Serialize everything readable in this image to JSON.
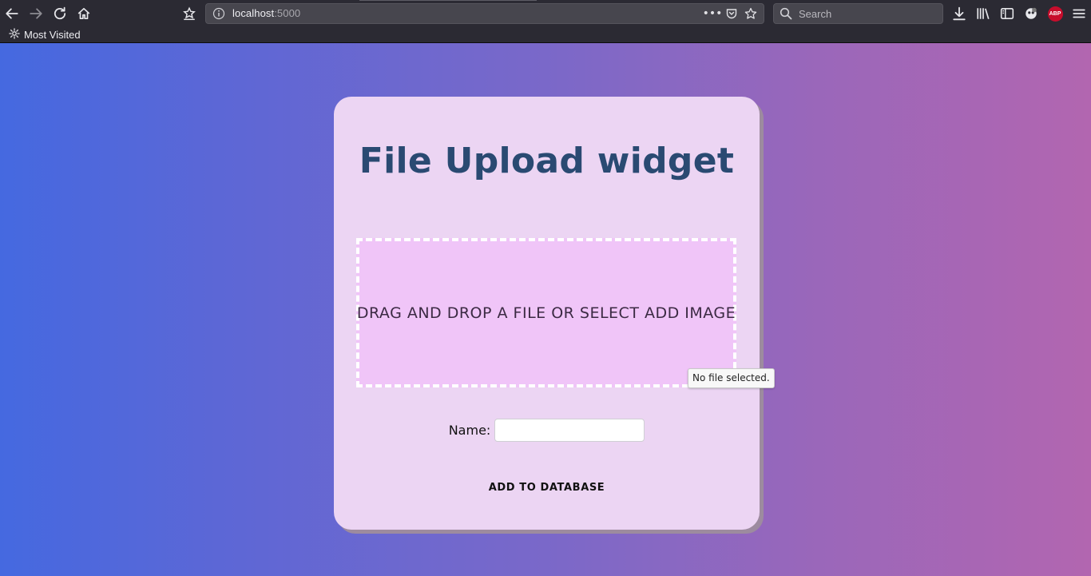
{
  "browser": {
    "url_host": "localhost",
    "url_port": ":5000",
    "search_placeholder": "Search",
    "bookmarks": [
      {
        "label": "Most Visited",
        "icon": "gear-icon"
      }
    ],
    "abp_label": "ABP",
    "colors": {
      "chrome_bg": "#2b2a33",
      "urlbar_bg": "#47464e"
    }
  },
  "card": {
    "title": "File Upload widget",
    "dropzone_text": "DRAG AND DROP A FILE OR SELECT ADD IMAGE",
    "file_tooltip": "No file selected.",
    "name_label": "Name:",
    "name_value": "",
    "submit_label": "ADD TO DATABASE"
  },
  "theme": {
    "gradient_start": "#4569e0",
    "gradient_end": "#b266b0",
    "card_bg": "#ecd5f3",
    "dropzone_bg": "#f0c5f8",
    "title_color": "#2a4a72"
  }
}
